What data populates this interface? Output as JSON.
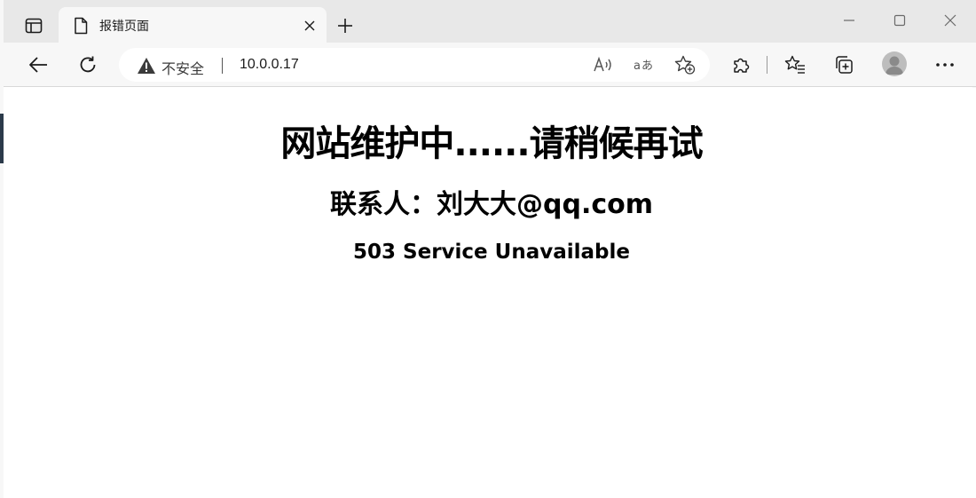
{
  "tab": {
    "title": "报错页面",
    "close_glyph": "✕"
  },
  "new_tab_glyph": "+",
  "window_controls": {
    "minimize": "—",
    "maximize": "☐",
    "close": "✕"
  },
  "address_bar": {
    "security_label": "不安全",
    "url": "10.0.0.17"
  },
  "page": {
    "heading": "网站维护中......请稍候再试",
    "contact": "联系人：刘大大@qq.com",
    "status": "503 Service Unavailable"
  },
  "toolbar": {
    "more_glyph": "···"
  }
}
